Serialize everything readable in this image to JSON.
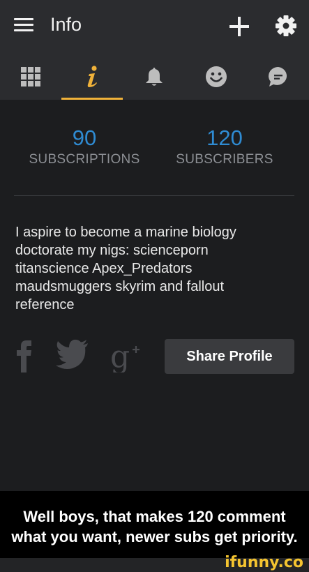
{
  "header": {
    "title": "Info",
    "menu_icon": "hamburger-menu-icon",
    "add_icon": "plus-icon",
    "settings_icon": "gear-icon"
  },
  "tabs": [
    {
      "icon": "grid-icon",
      "active": false
    },
    {
      "icon": "info-icon",
      "active": true
    },
    {
      "icon": "bell-icon",
      "active": false
    },
    {
      "icon": "smiley-icon",
      "active": false
    },
    {
      "icon": "chat-bubble-icon",
      "active": false
    }
  ],
  "stats": {
    "subscriptions": {
      "value": "90",
      "label": "SUBSCRIPTIONS"
    },
    "subscribers": {
      "value": "120",
      "label": "SUBSCRIBERS"
    }
  },
  "bio_lines": [
    "I aspire to become a marine biology",
    "doctorate my nigs: scienceporn",
    "titanscience  Apex_Predators",
    "maudsmuggers skyrim and fallout",
    "reference"
  ],
  "social": {
    "facebook_icon": "facebook-icon",
    "twitter_icon": "twitter-icon",
    "gplus_icon": "google-plus-icon",
    "share_label": "Share Profile"
  },
  "caption": {
    "line1": "Well boys, that makes 120 comment",
    "line2": "what you want, newer subs get priority."
  },
  "watermark": "ifunny.co",
  "colors": {
    "accent": "#f0b23a",
    "stat_number": "#2f8bd2",
    "bar_bg": "#2b2c2f",
    "page_bg": "#1c1d1f"
  }
}
